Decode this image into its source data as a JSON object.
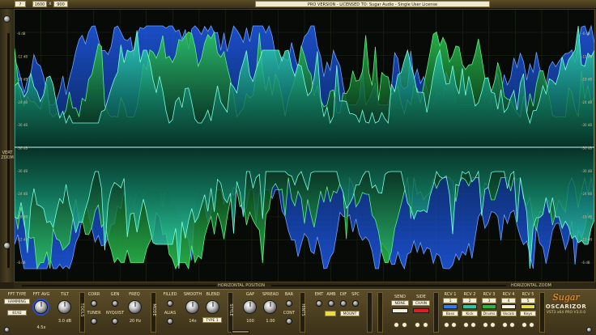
{
  "topbar": {
    "help": "?",
    "width": "1600",
    "x": "x",
    "height": "900",
    "license": "PRO VERSION - LICENSED TO: Sugar Audio - Single User License"
  },
  "scope": {
    "vert_zoom": "VERT\nZOOM",
    "db_labels_right": [
      "-6 dB",
      "-12 dB",
      "-18 dB",
      "-24 dB",
      "-30 dB",
      "-36 dB",
      "-30 dB",
      "-24 dB",
      "-18 dB",
      "-12 dB",
      "-6 dB"
    ],
    "db_labels_left": [
      "-6 dB",
      "-12 dB",
      "-18 dB",
      "-24 dB",
      "-30 dB",
      "-36 dB",
      "-30 dB",
      "-24 dB",
      "-18 dB",
      "-12 dB",
      "-6 dB"
    ],
    "colors": {
      "blue": "#1f5cf0",
      "green": "#2ed158",
      "cyan": "#36f0c8",
      "bg": "#050805"
    }
  },
  "hbar": {
    "position_label": "HORIZONTAL POSITION",
    "zoom_label": "HORIZONTAL ZOOM"
  },
  "panel": {
    "fft_type_label": "FFT TYPE",
    "fft_type_value": "HAMMING",
    "fft_size": "8192",
    "fft_avg_label": "FFT AVG",
    "fft_avg_value": "4.5x",
    "tilt_label": "TILT",
    "tilt_value": "3.0 dB",
    "tools_label": "TOOLS",
    "corr_label": "CORR",
    "tuner_label": "TUNER",
    "gen_label": "GEN",
    "nyquist_label": "NYQUIST",
    "freq_label": "FREQ",
    "freq_value": "20 Hz",
    "mode_label": "MODE",
    "filled_label": "FILLED",
    "alias_label": "ALIAS",
    "smooth_label": "SMOOTH",
    "smooth_value": "14x",
    "blend_label": "BLEND",
    "blend_value": "TYPE 1",
    "style_label": "STYLE",
    "gap_label": "GAP",
    "gap_value": "100",
    "spread_label": "SPREAD",
    "spread_value": "1.00",
    "bar_label": "BAR",
    "cont_label": "CONT",
    "hints_label": "HINTS",
    "emt_label": "EMT",
    "amb_label": "AMB",
    "dif_label": "DIF",
    "spc_label": "SPC",
    "mount_label": "MOUNT",
    "send_label": "SEND",
    "send_value": "NONE",
    "side_label": "SIDE",
    "side_value": "CHAIN",
    "rcv_labels": [
      "RCV 1",
      "RCV 2",
      "RCV 3",
      "RCV 4",
      "RCV 5"
    ],
    "rcv_numbers": [
      "1",
      "2",
      "3",
      "4",
      "5"
    ],
    "rcv_names": [
      "Bass",
      "Kick",
      "Drums",
      "Vocals",
      "Keys"
    ],
    "rcv_colors": [
      "#2f7cf2",
      "#26c9a4",
      "#28b83e",
      "#f4efdc",
      "#e8e238"
    ],
    "send_color": "#f4efdc",
    "side_color": "#e02020",
    "brand_logo": "Sugar",
    "brand_name": "OSCARIZOR",
    "brand_version": "VST3 x64 PRO V3.0.0"
  }
}
